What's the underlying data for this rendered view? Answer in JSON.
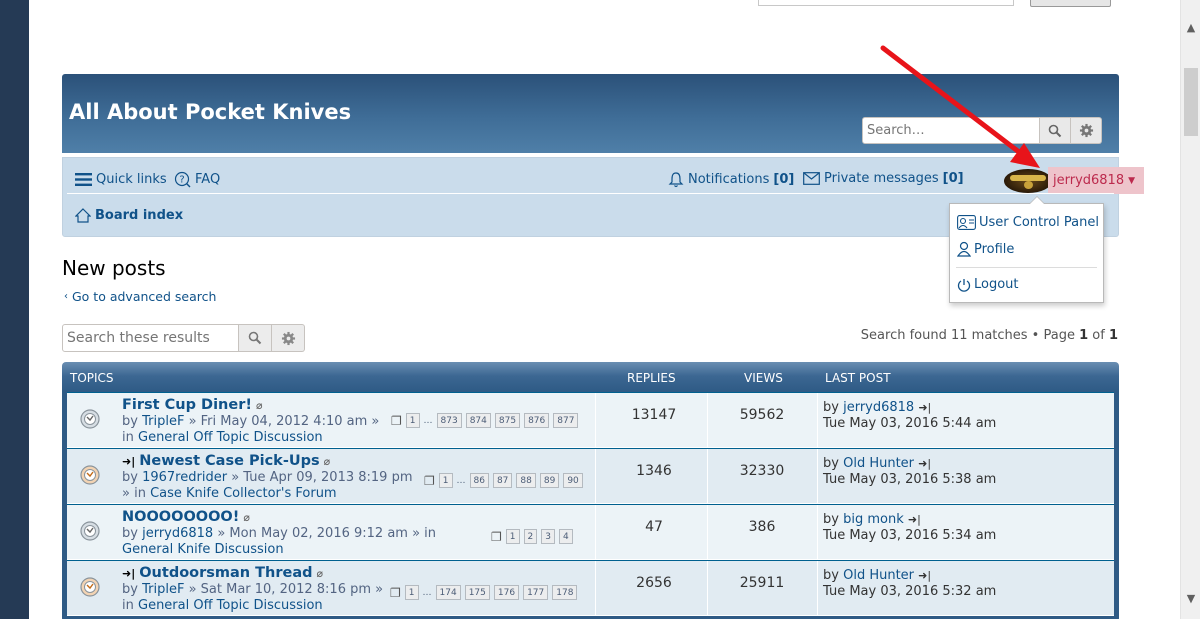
{
  "site": {
    "title": "All About Pocket Knives",
    "search_placeholder": "Search…"
  },
  "nav": {
    "quick_links": "Quick links",
    "faq": "FAQ",
    "notifications_label": "Notifications",
    "notifications_count": "[0]",
    "pm_label": "Private messages",
    "pm_count": "[0]",
    "username": "jerryd6818",
    "board_index": "Board index"
  },
  "user_menu": {
    "items": [
      "User Control Panel",
      "Profile",
      "Logout"
    ]
  },
  "page": {
    "title": "New posts",
    "advanced_search": "Go to advanced search",
    "results_search_placeholder": "Search these results",
    "results_text_prefix": "Search found 11 matches • Page",
    "page_current": "1",
    "page_of": "of",
    "page_total": "1"
  },
  "table": {
    "headers": {
      "topics": "Topics",
      "replies": "Replies",
      "views": "Views",
      "last_post": "Last post"
    },
    "rows": [
      {
        "title": "First Cup Diner!",
        "unread_marker": false,
        "by": "by",
        "author": "TripleF",
        "date": "» Fri May 04, 2012 4:10 am »",
        "forum_prefix": "in",
        "forum": "General Off Topic Discussion",
        "pages": [
          "1",
          "…",
          "873",
          "874",
          "875",
          "876",
          "877"
        ],
        "replies": "13147",
        "views": "59562",
        "last_by": "by",
        "last_author": "jerryd6818",
        "last_date": "Tue May 03, 2016 5:44 am"
      },
      {
        "title": "Newest Case Pick-Ups",
        "unread_marker": true,
        "by": "by",
        "author": "1967redrider",
        "date": "» Tue Apr 09, 2013 8:19 pm",
        "forum_prefix": "» in",
        "forum": "Case Knife Collector's Forum",
        "pages": [
          "1",
          "…",
          "86",
          "87",
          "88",
          "89",
          "90"
        ],
        "replies": "1346",
        "views": "32330",
        "last_by": "by",
        "last_author": "Old Hunter",
        "last_date": "Tue May 03, 2016 5:38 am"
      },
      {
        "title": "NOOOOOOOO!",
        "unread_marker": false,
        "by": "by",
        "author": "jerryd6818",
        "date": "» Mon May 02, 2016 9:12 am » in",
        "forum_prefix": "",
        "forum": "General Knife Discussion",
        "pages": [
          "1",
          "2",
          "3",
          "4"
        ],
        "replies": "47",
        "views": "386",
        "last_by": "by",
        "last_author": "big monk",
        "last_date": "Tue May 03, 2016 5:34 am"
      },
      {
        "title": "Outdoorsman Thread",
        "unread_marker": true,
        "by": "by",
        "author": "TripleF",
        "date": "» Sat Mar 10, 2012 8:16 pm »",
        "forum_prefix": "in",
        "forum": "General Off Topic Discussion",
        "pages": [
          "1",
          "…",
          "174",
          "175",
          "176",
          "177",
          "178"
        ],
        "replies": "2656",
        "views": "25911",
        "last_by": "by",
        "last_author": "Old Hunter",
        "last_date": "Tue May 03, 2016 5:32 am"
      }
    ]
  },
  "colors": {
    "outer_background": "#253a55",
    "header_blue": "#3f6d97",
    "navbar_bg": "#cadceb",
    "link_blue": "#105289",
    "user_tab_bg": "#eec4cb",
    "user_tab_text": "#bc2a4d",
    "row_bg": "#ecf3f7",
    "row_alt_bg": "#e1ebf2",
    "annotation_arrow": "#e8141a"
  },
  "icons": {
    "search": "search-icon",
    "settings": "gear-icon",
    "menu": "hamburger-icon",
    "faq": "question-icon",
    "bell": "bell-icon",
    "mail": "envelope-icon",
    "home": "home-icon",
    "attachment": "paperclip-icon",
    "goto_last": "goto-last-post-icon",
    "topic": "topic-read-icon"
  }
}
